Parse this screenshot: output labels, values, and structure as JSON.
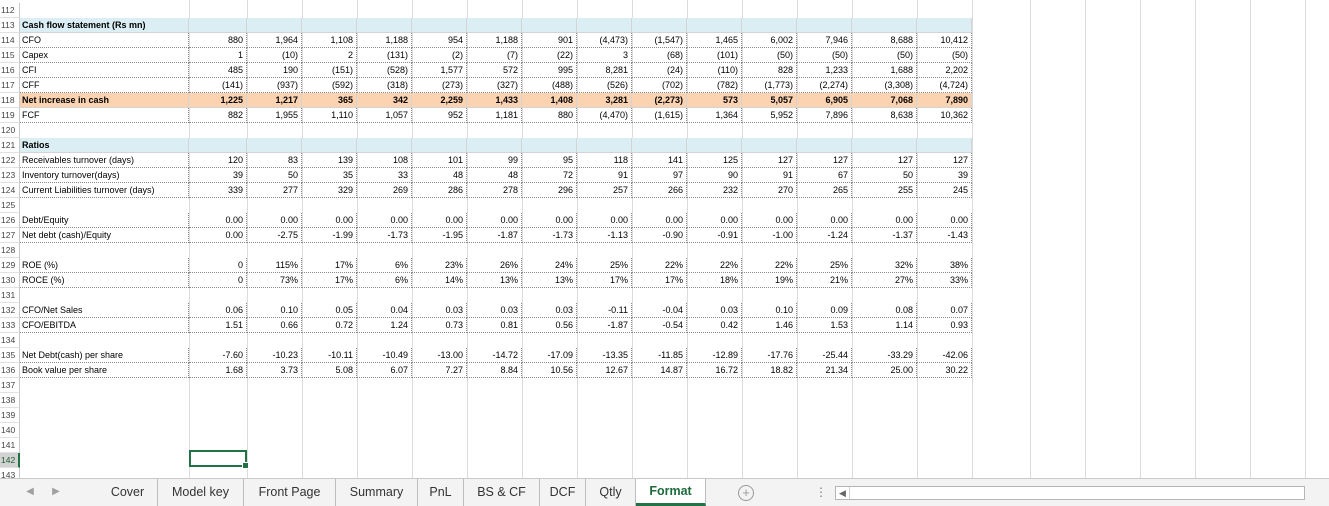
{
  "colors": {
    "accent": "#217346",
    "header_band": "#dbeef4",
    "highlight_band": "#fbd3b1"
  },
  "selected_row": "142",
  "rows": [
    {
      "n": "112"
    },
    {
      "n": "113",
      "style": "band-blue",
      "label": "Cash flow statement (Rs mn)",
      "values": [
        "",
        "",
        "",
        "",
        "",
        "",
        "",
        "",
        "",
        "",
        "",
        "",
        "",
        ""
      ]
    },
    {
      "n": "114",
      "style": "dotted",
      "label": "CFO",
      "values": [
        "880",
        "1,964",
        "1,108",
        "1,188",
        "954",
        "1,188",
        "901",
        "(4,473)",
        "(1,547)",
        "1,465",
        "6,002",
        "7,946",
        "8,688",
        "10,412"
      ]
    },
    {
      "n": "115",
      "style": "dotted",
      "label": "Capex",
      "values": [
        "1",
        "(10)",
        "2",
        "(131)",
        "(2)",
        "(7)",
        "(22)",
        "3",
        "(68)",
        "(101)",
        "(50)",
        "(50)",
        "(50)",
        "(50)"
      ]
    },
    {
      "n": "116",
      "style": "dotted",
      "label": "CFI",
      "values": [
        "485",
        "190",
        "(151)",
        "(528)",
        "1,577",
        "572",
        "995",
        "8,281",
        "(24)",
        "(110)",
        "828",
        "1,233",
        "1,688",
        "2,202"
      ]
    },
    {
      "n": "117",
      "style": "dotted",
      "label": "CFF",
      "values": [
        "(141)",
        "(937)",
        "(592)",
        "(318)",
        "(273)",
        "(327)",
        "(488)",
        "(526)",
        "(702)",
        "(782)",
        "(1,773)",
        "(2,274)",
        "(3,308)",
        "(4,724)"
      ]
    },
    {
      "n": "118",
      "style": "band-orange",
      "label": "Net increase in cash",
      "values": [
        "1,225",
        "1,217",
        "365",
        "342",
        "2,259",
        "1,433",
        "1,408",
        "3,281",
        "(2,273)",
        "573",
        "5,057",
        "6,905",
        "7,068",
        "7,890"
      ]
    },
    {
      "n": "119",
      "style": "dotted",
      "label": "FCF",
      "values": [
        "882",
        "1,955",
        "1,110",
        "1,057",
        "952",
        "1,181",
        "880",
        "(4,470)",
        "(1,615)",
        "1,364",
        "5,952",
        "7,896",
        "8,638",
        "10,362"
      ]
    },
    {
      "n": "120"
    },
    {
      "n": "121",
      "style": "band-blue",
      "label": "Ratios",
      "values": [
        "",
        "",
        "",
        "",
        "",
        "",
        "",
        "",
        "",
        "",
        "",
        "",
        "",
        ""
      ]
    },
    {
      "n": "122",
      "style": "dotted",
      "label": "Receivables turnover (days)",
      "values": [
        "120",
        "83",
        "139",
        "108",
        "101",
        "99",
        "95",
        "118",
        "141",
        "125",
        "127",
        "127",
        "127",
        "127"
      ]
    },
    {
      "n": "123",
      "style": "dotted",
      "label": "Inventory turnover(days)",
      "values": [
        "39",
        "50",
        "35",
        "33",
        "48",
        "48",
        "72",
        "91",
        "97",
        "90",
        "91",
        "67",
        "50",
        "39"
      ]
    },
    {
      "n": "124",
      "style": "dotted",
      "label": "Current Liabilities turnover (days)",
      "values": [
        "339",
        "277",
        "329",
        "269",
        "286",
        "278",
        "296",
        "257",
        "266",
        "232",
        "270",
        "265",
        "255",
        "245"
      ]
    },
    {
      "n": "125"
    },
    {
      "n": "126",
      "style": "dotted",
      "label": "Debt/Equity",
      "values": [
        "0.00",
        "0.00",
        "0.00",
        "0.00",
        "0.00",
        "0.00",
        "0.00",
        "0.00",
        "0.00",
        "0.00",
        "0.00",
        "0.00",
        "0.00",
        "0.00"
      ]
    },
    {
      "n": "127",
      "style": "dotted",
      "label": "Net debt (cash)/Equity",
      "values": [
        "0.00",
        "-2.75",
        "-1.99",
        "-1.73",
        "-1.95",
        "-1.87",
        "-1.73",
        "-1.13",
        "-0.90",
        "-0.91",
        "-1.00",
        "-1.24",
        "-1.37",
        "-1.43"
      ]
    },
    {
      "n": "128"
    },
    {
      "n": "129",
      "style": "dotted",
      "label": "ROE (%)",
      "values": [
        "0",
        "115%",
        "17%",
        "6%",
        "23%",
        "26%",
        "24%",
        "25%",
        "22%",
        "22%",
        "22%",
        "25%",
        "32%",
        "38%"
      ]
    },
    {
      "n": "130",
      "style": "dotted",
      "label": "ROCE (%)",
      "values": [
        "0",
        "73%",
        "17%",
        "6%",
        "14%",
        "13%",
        "13%",
        "17%",
        "17%",
        "18%",
        "19%",
        "21%",
        "27%",
        "33%"
      ]
    },
    {
      "n": "131"
    },
    {
      "n": "132",
      "style": "dotted",
      "label": "CFO/Net Sales",
      "values": [
        "0.06",
        "0.10",
        "0.05",
        "0.04",
        "0.03",
        "0.03",
        "0.03",
        "-0.11",
        "-0.04",
        "0.03",
        "0.10",
        "0.09",
        "0.08",
        "0.07"
      ]
    },
    {
      "n": "133",
      "style": "dotted",
      "label": "CFO/EBITDA",
      "values": [
        "1.51",
        "0.66",
        "0.72",
        "1.24",
        "0.73",
        "0.81",
        "0.56",
        "-1.87",
        "-0.54",
        "0.42",
        "1.46",
        "1.53",
        "1.14",
        "0.93"
      ]
    },
    {
      "n": "134"
    },
    {
      "n": "135",
      "style": "dotted",
      "label": "Net Debt(cash) per share",
      "values": [
        "-7.60",
        "-10.23",
        "-10.11",
        "-10.49",
        "-13.00",
        "-14.72",
        "-17.09",
        "-13.35",
        "-11.85",
        "-12.89",
        "-17.76",
        "-25.44",
        "-33.29",
        "-42.06"
      ]
    },
    {
      "n": "136",
      "style": "dotted",
      "label": "Book value per share",
      "values": [
        "1.68",
        "3.73",
        "5.08",
        "6.07",
        "7.27",
        "8.84",
        "10.56",
        "12.67",
        "14.87",
        "16.72",
        "18.82",
        "21.34",
        "25.00",
        "30.22"
      ]
    },
    {
      "n": "137"
    },
    {
      "n": "138"
    },
    {
      "n": "139"
    },
    {
      "n": "140"
    },
    {
      "n": "141"
    },
    {
      "n": "142"
    },
    {
      "n": "143"
    }
  ],
  "tabs": [
    {
      "label": "Cover"
    },
    {
      "label": "Model key"
    },
    {
      "label": "Front Page"
    },
    {
      "label": "Summary"
    },
    {
      "label": "PnL"
    },
    {
      "label": "BS & CF"
    },
    {
      "label": "DCF"
    },
    {
      "label": "Qtly"
    },
    {
      "label": "Format",
      "active": true
    }
  ],
  "icons": {
    "prev_sheet": "◀",
    "next_sheet": "▶",
    "add_sheet": "+",
    "more": "⋮",
    "scroll_left": "◀"
  }
}
